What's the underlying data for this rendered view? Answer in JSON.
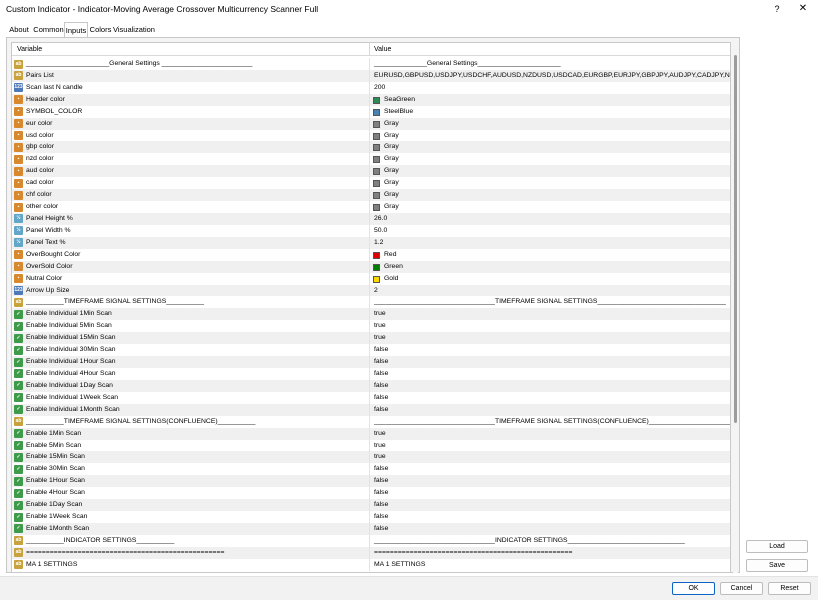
{
  "window": {
    "title": "Custom Indicator - Indicator-Moving Average Crossover Multicurrency Scanner Full",
    "help_label": "?",
    "close_label": "✕"
  },
  "tabs": [
    {
      "label": "About"
    },
    {
      "label": "Common"
    },
    {
      "label": "Inputs"
    },
    {
      "label": "Colors"
    },
    {
      "label": "Visualization"
    }
  ],
  "active_tab": "Inputs",
  "grid": {
    "col_variable": "Variable",
    "col_value": "Value"
  },
  "rows": [
    {
      "type": "ab",
      "var": "______________________General Settings ________________________",
      "value": "______________General Settings______________________"
    },
    {
      "type": "ab",
      "var": "Pairs List",
      "value": "EURUSD,GBPUSD,USDJPY,USDCHF,AUDUSD,NZDUSD,USDCAD,EURGBP,EURJPY,GBPJPY,AUDJPY,CADJPY,NZD..."
    },
    {
      "type": "num",
      "var": "Scan last N candle",
      "value": "200"
    },
    {
      "type": "clr",
      "var": "Header color",
      "value": "SeaGreen",
      "color": "#2e8b57"
    },
    {
      "type": "clr",
      "var": "SYMBOL_COLOR",
      "value": "SteelBlue",
      "color": "#4682b4"
    },
    {
      "type": "clr",
      "var": "eur color",
      "value": "Gray",
      "color": "#808080"
    },
    {
      "type": "clr",
      "var": "usd color",
      "value": "Gray",
      "color": "#808080"
    },
    {
      "type": "clr",
      "var": "gbp color",
      "value": "Gray",
      "color": "#808080"
    },
    {
      "type": "clr",
      "var": "nzd color",
      "value": "Gray",
      "color": "#808080"
    },
    {
      "type": "clr",
      "var": "aud color",
      "value": "Gray",
      "color": "#808080"
    },
    {
      "type": "clr",
      "var": "cad color",
      "value": "Gray",
      "color": "#808080"
    },
    {
      "type": "clr",
      "var": "chf color",
      "value": "Gray",
      "color": "#808080"
    },
    {
      "type": "clr",
      "var": "other color",
      "value": "Gray",
      "color": "#808080"
    },
    {
      "type": "dbl",
      "var": "Panel Height %",
      "value": "26.0"
    },
    {
      "type": "dbl",
      "var": "Panel Width %",
      "value": "50.0"
    },
    {
      "type": "dbl",
      "var": "Panel Text %",
      "value": "1.2"
    },
    {
      "type": "clr",
      "var": "OverBought Color",
      "value": "Red",
      "color": "#e00000"
    },
    {
      "type": "clr",
      "var": "OverSold Color",
      "value": "Green",
      "color": "#008000"
    },
    {
      "type": "clr",
      "var": "Nutral Color",
      "value": "Gold",
      "color": "#ffd700"
    },
    {
      "type": "num",
      "var": "Arrow Up Size",
      "value": "2"
    },
    {
      "type": "ab",
      "var": "__________TIMEFRAME SIGNAL SETTINGS__________",
      "value": "________________________________TIMEFRAME SIGNAL SETTINGS__________________________________"
    },
    {
      "type": "bool",
      "var": "Enable Individual 1Min Scan",
      "value": "true"
    },
    {
      "type": "bool",
      "var": "Enable Individual 5Min Scan",
      "value": "true"
    },
    {
      "type": "bool",
      "var": "Enable Individual 15Min Scan",
      "value": "true"
    },
    {
      "type": "bool",
      "var": "Enable Individual 30Min Scan",
      "value": "false"
    },
    {
      "type": "bool",
      "var": "Enable Individual 1Hour Scan",
      "value": "false"
    },
    {
      "type": "bool",
      "var": "Enable Individual 4Hour Scan",
      "value": "false"
    },
    {
      "type": "bool",
      "var": "Enable Individual 1Day Scan",
      "value": "false"
    },
    {
      "type": "bool",
      "var": "Enable Individual 1Week Scan",
      "value": "false"
    },
    {
      "type": "bool",
      "var": "Enable Individual 1Month Scan",
      "value": "false"
    },
    {
      "type": "ab",
      "var": "__________TIMEFRAME SIGNAL SETTINGS(CONFLUENCE)__________",
      "value": "________________________________TIMEFRAME SIGNAL SETTINGS(CONFLUENCE)_______________________________"
    },
    {
      "type": "bool",
      "var": "Enable 1Min Scan",
      "value": "true"
    },
    {
      "type": "bool",
      "var": "Enable 5Min Scan",
      "value": "true"
    },
    {
      "type": "bool",
      "var": "Enable 15Min Scan",
      "value": "true"
    },
    {
      "type": "bool",
      "var": "Enable 30Min Scan",
      "value": "false"
    },
    {
      "type": "bool",
      "var": "Enable 1Hour Scan",
      "value": "false"
    },
    {
      "type": "bool",
      "var": "Enable 4Hour Scan",
      "value": "false"
    },
    {
      "type": "bool",
      "var": "Enable 1Day Scan",
      "value": "false"
    },
    {
      "type": "bool",
      "var": "Enable 1Week Scan",
      "value": "false"
    },
    {
      "type": "bool",
      "var": "Enable 1Month Scan",
      "value": "false"
    },
    {
      "type": "ab",
      "var": "__________INDICATOR SETTINGS__________",
      "value": "________________________________INDICATOR SETTINGS_______________________________"
    },
    {
      "type": "ab",
      "var": "==================================================",
      "value": "=================================================="
    },
    {
      "type": "ab",
      "var": "MA 1 SETTINGS",
      "value": "MA 1 SETTINGS"
    }
  ],
  "side_buttons": {
    "load": "Load",
    "save": "Save"
  },
  "bottom_buttons": {
    "ok": "OK",
    "cancel": "Cancel",
    "reset": "Reset"
  }
}
